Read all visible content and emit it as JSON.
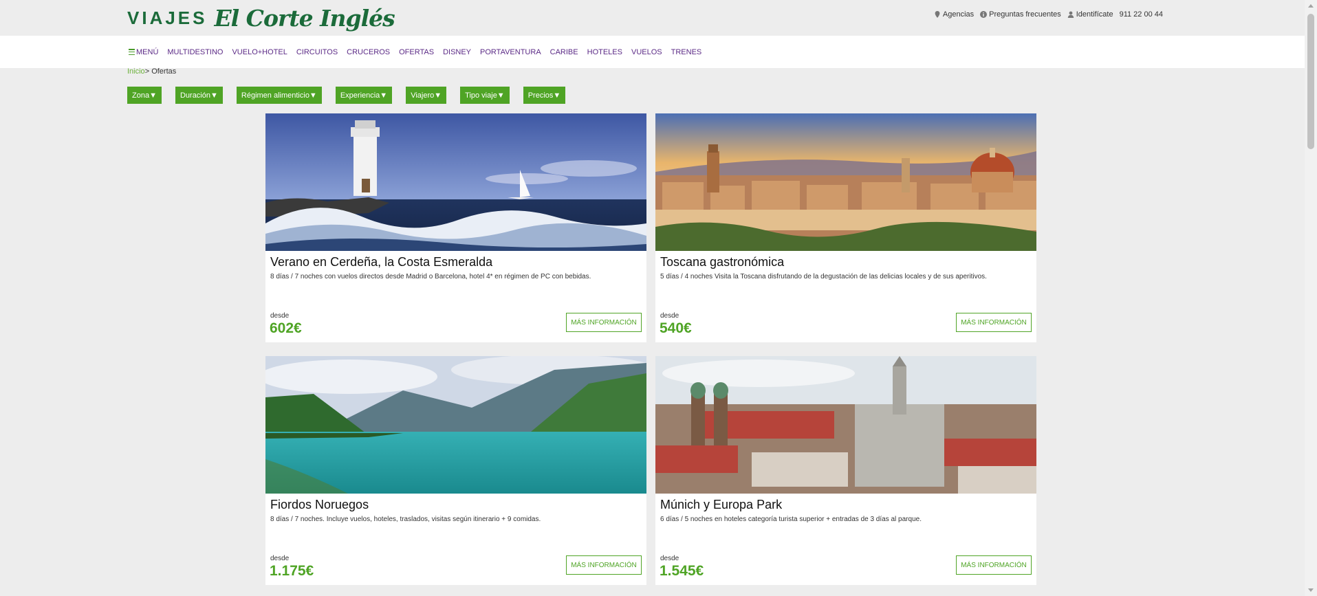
{
  "brand": {
    "viajes": "VIAJES",
    "eci": "El Corte Inglés"
  },
  "util": {
    "agencias": "Agencias",
    "faq": "Preguntas frecuentes",
    "login": "Identifícate",
    "phone": "911 22 00 44"
  },
  "nav": {
    "menu": "MENÚ",
    "items": [
      "MULTIDESTINO",
      "VUELO+HOTEL",
      "CIRCUITOS",
      "CRUCEROS",
      "OFERTAS",
      "DISNEY",
      "PORTAVENTURA",
      "CARIBE",
      "HOTELES",
      "VUELOS",
      "TRENES"
    ]
  },
  "breadcrumb": {
    "home": "Inicio",
    "sep": ">",
    "current": "Ofertas"
  },
  "filters": [
    "Zona▼",
    "Duración▼",
    "Régimen alimenticio▼",
    "Experiencia▼",
    "Viajero▼",
    "Tipo viaje▼",
    "Precios▼"
  ],
  "cards": [
    {
      "title": "Verano en Cerdeña, la Costa Esmeralda",
      "desc": "8 días / 7 noches con vuelos directos desde Madrid o Barcelona, hotel 4* en régimen de PC con bebidas.",
      "desde": "desde",
      "price": "602€",
      "cta": "MÁS INFORMACIÓN"
    },
    {
      "title": "Toscana gastronómica",
      "desc": "5 días / 4 noches Visita la Toscana disfrutando de la degustación de las delicias locales y de sus aperitivos.",
      "desde": "desde",
      "price": "540€",
      "cta": "MÁS INFORMACIÓN"
    },
    {
      "title": "Fiordos Noruegos",
      "desc": "8 días / 7 noches. Incluye vuelos, hoteles, traslados, visitas según itinerario + 9 comidas.",
      "desde": "desde",
      "price": "1.175€",
      "cta": "MÁS INFORMACIÓN"
    },
    {
      "title": "Múnich y Europa Park",
      "desc": "6 días / 5 noches en hoteles categoría turista superior + entradas de 3 días al parque.",
      "desde": "desde",
      "price": "1.545€",
      "cta": "MÁS INFORMACIÓN"
    }
  ],
  "colors": {
    "accent": "#4fa425",
    "brand": "#1b6b3a",
    "nav": "#5b2a86"
  }
}
